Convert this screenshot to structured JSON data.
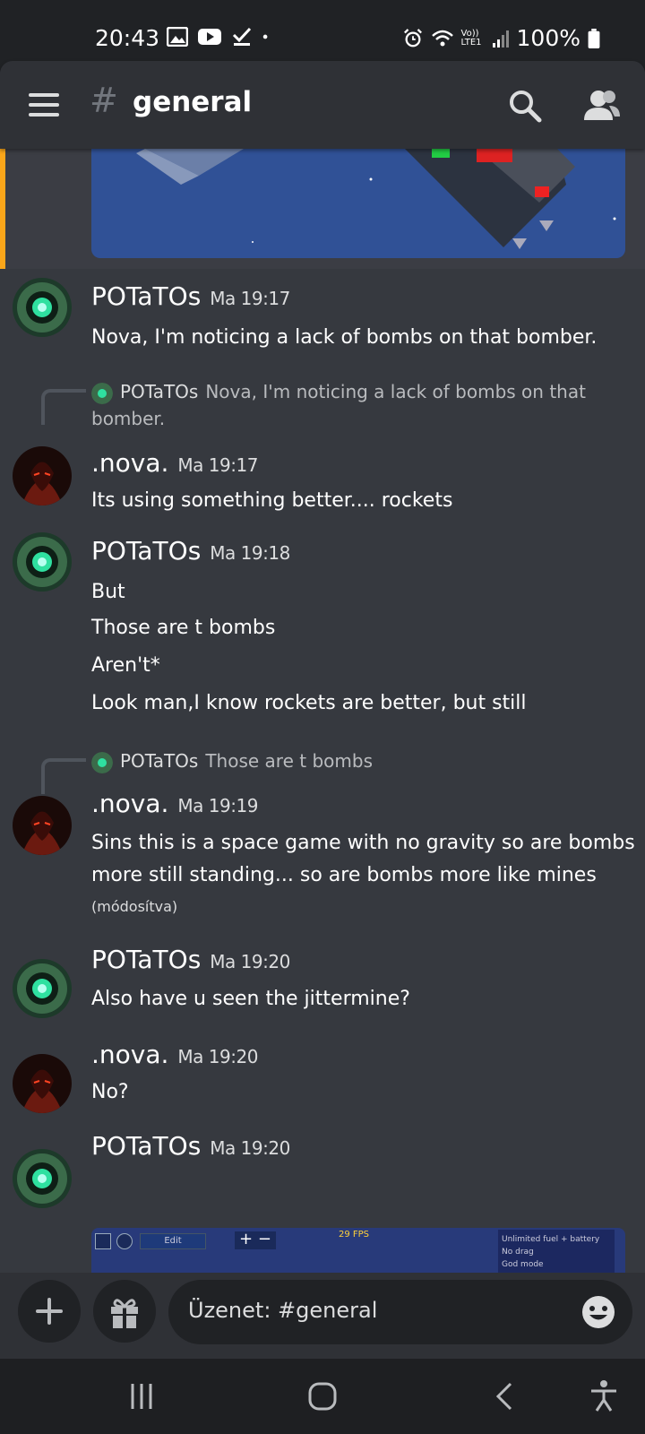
{
  "status_bar": {
    "time": "20:43",
    "network_label": "Vo)) LTE1",
    "battery": "100%",
    "left_icons": [
      "image-icon",
      "youtube-icon",
      "check-icon",
      "dot-icon"
    ],
    "right_icons": [
      "alarm-icon",
      "wifi-icon",
      "signal-icon",
      "battery-icon"
    ]
  },
  "header": {
    "hash": "#",
    "channel_name": "general"
  },
  "messages": [
    {
      "author": "POTaTOs",
      "time": "Ma 19:17",
      "lines": [
        "Nova, I'm noticing a lack of bombs on that bomber."
      ]
    },
    {
      "reply_to": {
        "author": "POTaTOs",
        "text": "Nova, I'm noticing a lack of bombs on that bomber."
      },
      "author": ".nova.",
      "time": "Ma 19:17",
      "lines": [
        "Its using something better.... rockets"
      ]
    },
    {
      "author": "POTaTOs",
      "time": "Ma 19:18",
      "lines": [
        "But",
        "Those are t bombs",
        "Aren't*",
        "Look man,I know rockets are better, but still"
      ]
    },
    {
      "reply_to": {
        "author": "POTaTOs",
        "text": "Those are t bombs"
      },
      "author": ".nova.",
      "time": "Ma 19:19",
      "lines": [
        "Sins this is a space game with no gravity so are bombs",
        "more still standing... so are bombs more like mines"
      ],
      "edited": "(módosítva)"
    },
    {
      "author": "POTaTOs",
      "time": "Ma 19:20",
      "lines": [
        "Also have u seen the jittermine?"
      ]
    },
    {
      "author": ".nova.",
      "time": "Ma 19:20",
      "lines": [
        "No?"
      ]
    },
    {
      "author": "POTaTOs",
      "time": "Ma 19:20",
      "lines": []
    }
  ],
  "embed": {
    "edit_label": "Edit",
    "fps": "29 FPS",
    "options": [
      "Unlimited fuel + battery",
      "No drag",
      "God mode"
    ]
  },
  "composer": {
    "placeholder": "Üzenet: #general"
  },
  "colors": {
    "background": "#36393f",
    "header": "#2f3136",
    "input": "#202225",
    "accent_bar": "#faa61a"
  }
}
